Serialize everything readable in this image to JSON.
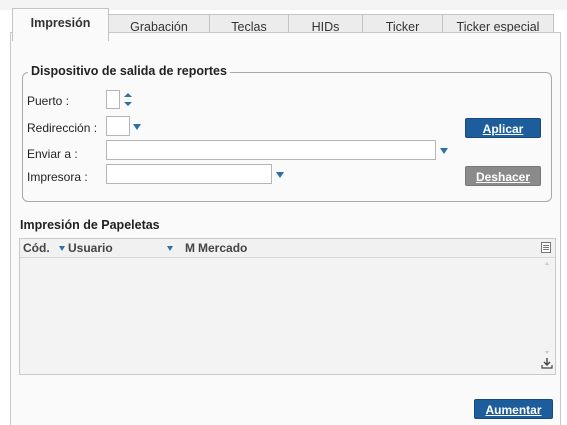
{
  "tabs": [
    {
      "label": "Impresión",
      "active": true
    },
    {
      "label": "Grabación",
      "underline_index": 0
    },
    {
      "label": "Teclas",
      "underline_index": 0
    },
    {
      "label": "HIDs"
    },
    {
      "label": "Ticker",
      "underline_index": 3
    },
    {
      "label": "Ticker especial",
      "underline_index": 5
    }
  ],
  "report_output": {
    "title": "Dispositivo de salida de reportes",
    "puerto_label": "Puerto :",
    "puerto_value": "",
    "redireccion_label": "Redirección :",
    "redireccion_value": "",
    "enviar_label": "Enviar a :",
    "enviar_value": "",
    "impresora_label": "Impresora :",
    "impresora_value": "",
    "apply_button": "Aplicar",
    "undo_button": "Deshacer"
  },
  "slips": {
    "title": "Impresión de Papeletas",
    "columns": [
      "Cód.",
      "Usuario",
      "M",
      "Mercado"
    ],
    "rows": []
  },
  "increase_button": "Aumentar",
  "colors": {
    "accent": "#1e5d9c",
    "disabled": "#8a8a8a",
    "dropdown_arrow": "#2f6fa8"
  },
  "icons": [
    "spinner-icon",
    "dropdown-arrow-icon",
    "column-menu-icon",
    "download-icon"
  ]
}
